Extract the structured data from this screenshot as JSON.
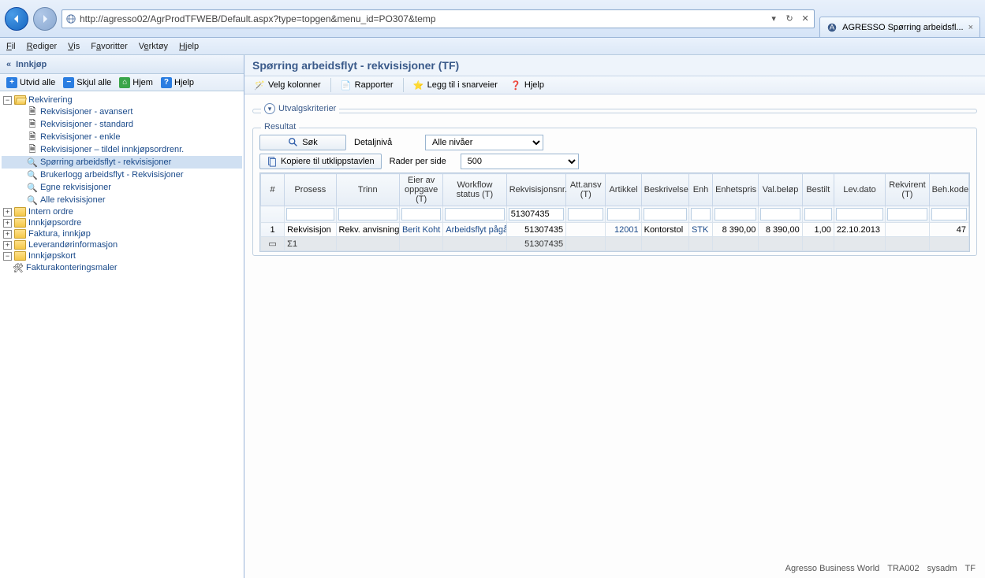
{
  "browser": {
    "url": "http://agresso02/AgrProdTFWEB/Default.aspx?type=topgen&menu_id=PO307&temp",
    "tab_title": "AGRESSO Spørring arbeidsfl..."
  },
  "menubar": [
    "Fil",
    "Rediger",
    "Vis",
    "Favoritter",
    "Verktøy",
    "Hjelp"
  ],
  "sidebar": {
    "title": "Innkjøp",
    "tools": {
      "expand": "Utvid alle",
      "collapse": "Skjul alle",
      "home": "Hjem",
      "help": "Hjelp"
    },
    "tree": {
      "rekvirering": "Rekvirering",
      "items": [
        "Rekvisisjoner - avansert",
        "Rekvisisjoner - standard",
        "Rekvisisjoner - enkle",
        "Rekvisisjoner – tildel innkjøpsordrenr.",
        "Spørring arbeidsflyt - rekvisisjoner",
        "Brukerlogg arbeidsflyt - Rekvisisjoner",
        "Egne rekvisisjoner",
        "Alle rekvisisjoner"
      ],
      "folders": [
        "Intern ordre",
        "Innkjøpsordre",
        "Faktura, innkjøp",
        "Leverandørinformasjon",
        "Innkjøpskort"
      ],
      "last": "Fakturakonteringsmaler"
    }
  },
  "content": {
    "title": "Spørring arbeidsflyt - rekvisisjoner (TF)",
    "toolbar": {
      "cols": "Velg kolonner",
      "reports": "Rapporter",
      "shortcut": "Legg til i snarveier",
      "help": "Hjelp"
    },
    "criteria_legend": "Utvalgskriterier",
    "result_legend": "Resultat",
    "controls": {
      "search": "Søk",
      "detail_label": "Detaljnivå",
      "detail_value": "Alle nivåer",
      "copy": "Kopiere til utklippstavlen",
      "rows_label": "Rader per side",
      "rows_value": "500"
    },
    "grid": {
      "headers": [
        "#",
        "Prosess",
        "Trinn",
        "Eier av oppgave (T)",
        "Workflow status (T)",
        "Rekvisisjonsnr.",
        "Att.ansv (T)",
        "Artikkel",
        "Beskrivelse",
        "Enh",
        "Enhetspris",
        "Val.beløp",
        "Bestilt",
        "Lev.dato",
        "Rekvirent (T)",
        "Beh.kode"
      ],
      "filter_rekv": "51307435",
      "row": {
        "num": "1",
        "prosess": "Rekvisisjon",
        "trinn": "Rekv. anvisning",
        "eier": "Berit Koht",
        "status": "Arbeidsflyt pågår",
        "rekv": "51307435",
        "att": "",
        "artikkel": "12001",
        "beskr": "Kontorstol",
        "enh": "STK",
        "pris": "8 390,00",
        "belop": "8 390,00",
        "bestilt": "1,00",
        "dato": "22.10.2013",
        "rekvirent": "",
        "kode": "47"
      },
      "sum": {
        "label": "Σ1",
        "rekv": "51307435"
      }
    },
    "footer": {
      "app": "Agresso Business World",
      "env": "TRA002",
      "user": "sysadm",
      "co": "TF"
    }
  }
}
